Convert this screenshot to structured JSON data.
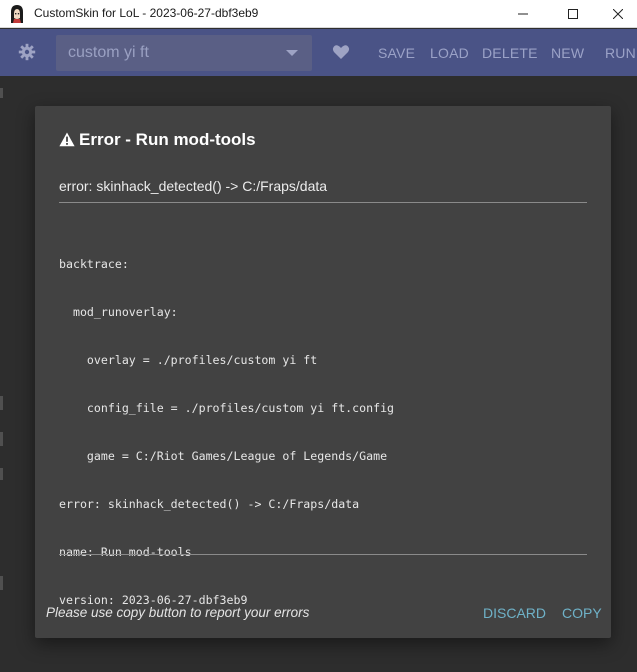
{
  "window": {
    "title": "CustomSkin for LoL - 2023-06-27-dbf3eb9"
  },
  "toolbar": {
    "profile_value": "custom yi ft",
    "save_label": "SAVE",
    "load_label": "LOAD",
    "delete_label": "DELETE",
    "new_label": "NEW",
    "run_label": "RUN"
  },
  "dialog": {
    "title": "Error - Run mod-tools",
    "error_message": "error: skinhack_detected() -> C:/Fraps/data",
    "trace_lines": [
      "backtrace:",
      "  mod_runoverlay:",
      "    overlay = ./profiles/custom yi ft",
      "    config_file = ./profiles/custom yi ft.config",
      "    game = C:/Riot Games/League of Legends/Game",
      "error: skinhack_detected() -> C:/Fraps/data",
      "name: Run mod-tools",
      "version: 2023-06-27-dbf3eb9"
    ],
    "footer_note": "Please use copy button to report your errors",
    "discard_label": "DISCARD",
    "copy_label": "COPY"
  },
  "colors": {
    "toolbar_bg": "#4a5386",
    "dialog_bg": "#424242",
    "accent_button": "#6fb2c8"
  },
  "icons": [
    "app-icon",
    "minimize-icon",
    "maximize-icon",
    "close-icon",
    "gear-icon",
    "chevron-down-icon",
    "heart-icon",
    "warning-icon"
  ]
}
